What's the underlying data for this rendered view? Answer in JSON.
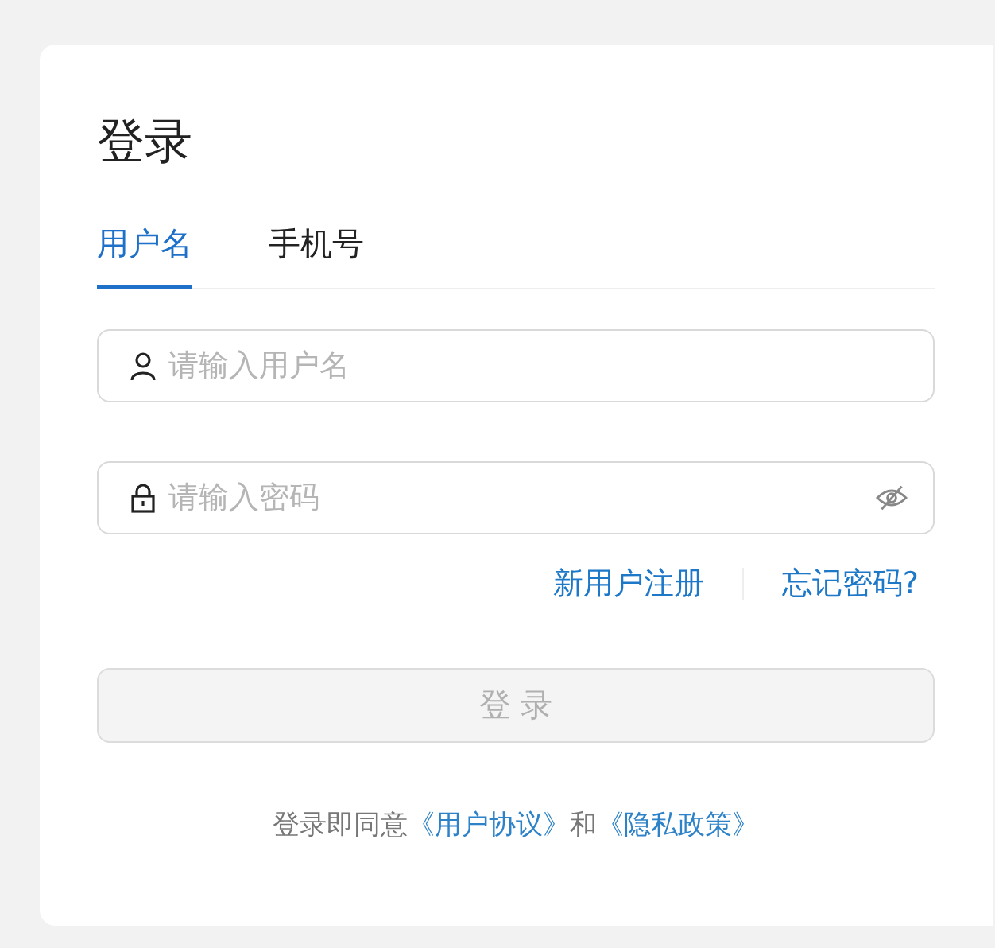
{
  "title": "登录",
  "tabs": [
    {
      "label": "用户名",
      "selected": true
    },
    {
      "label": "手机号",
      "selected": false
    }
  ],
  "fields": [
    {
      "kind": "user",
      "placeholder": "请输入用户名"
    },
    {
      "kind": "password",
      "placeholder": "请输入密码"
    }
  ],
  "links": [
    "新用户注册",
    "忘记密码?"
  ],
  "login_button": {
    "label": "登 录",
    "disabled": true
  },
  "agreement": [
    {
      "kind": "text",
      "text": "登录即同意"
    },
    {
      "kind": "link",
      "text": "《用户协议》"
    },
    {
      "kind": "text",
      "text": "和"
    },
    {
      "kind": "link",
      "text": "《隐私政策》"
    }
  ]
}
